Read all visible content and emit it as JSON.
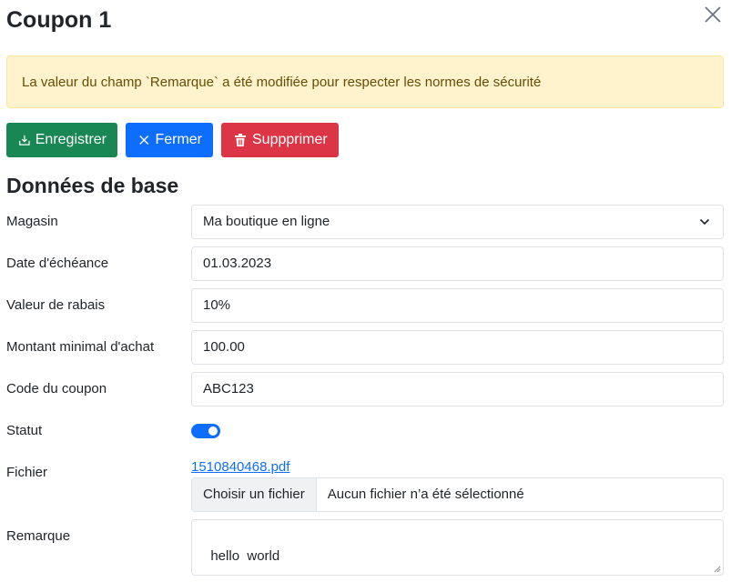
{
  "modal": {
    "title": "Coupon 1",
    "alert": "La valeur du champ `Remarque` a été modifiée pour respecter les normes de sécurité"
  },
  "toolbar": {
    "save_label": "Enregistrer",
    "close_label": "Fermer",
    "delete_label": "Suppprimer"
  },
  "section": {
    "title": "Données de base"
  },
  "fields": {
    "store": {
      "label": "Magasin",
      "value": "Ma boutique en ligne"
    },
    "due_date": {
      "label": "Date d'échéance",
      "value": "01.03.2023"
    },
    "discount": {
      "label": "Valeur de rabais",
      "value": "10%"
    },
    "min_amount": {
      "label": "Montant minimal d'achat",
      "value": "100.00"
    },
    "code": {
      "label": "Code du coupon",
      "value": "ABC123"
    },
    "status": {
      "label": "Statut",
      "enabled": true
    },
    "file": {
      "label": "Fichier",
      "link": "1510840468.pdf",
      "button": "Choisir un fichier",
      "status": "Aucun fichier n’a été sélectionné"
    },
    "remark": {
      "label": "Remarque",
      "value": "hello  world"
    }
  },
  "colors": {
    "success": "#198754",
    "primary": "#0d6efd",
    "danger": "#dc3545",
    "warning_bg": "#fff3cd",
    "warning_text": "#664d03"
  },
  "icons": {
    "close": "close-icon",
    "save": "save-icon",
    "x": "x-icon",
    "trash": "trash-icon",
    "chevron": "chevron-down-icon"
  }
}
